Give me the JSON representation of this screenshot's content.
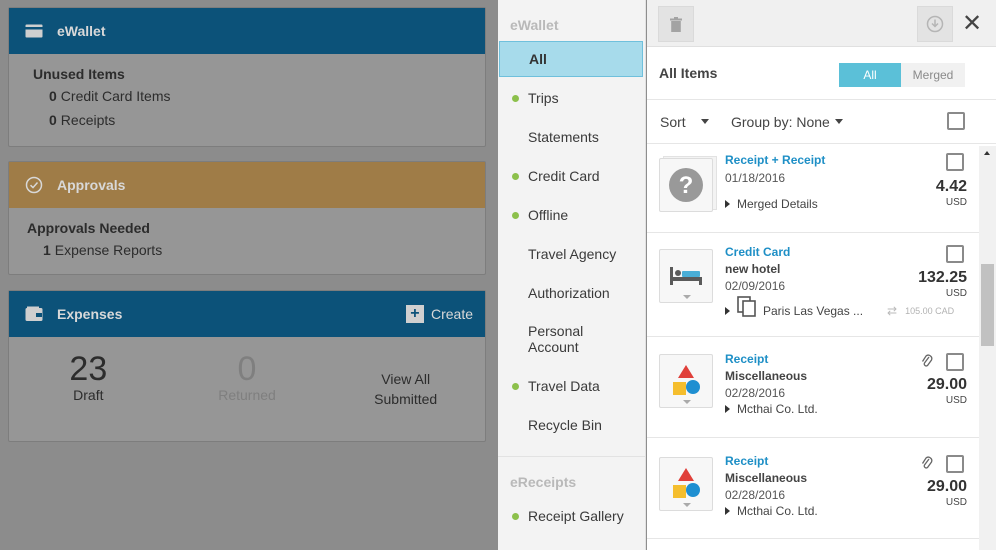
{
  "dashboard": {
    "wallet": {
      "title": "eWallet",
      "section": "Unused Items",
      "rows": [
        {
          "count": "0",
          "label": "Credit Card Items"
        },
        {
          "count": "0",
          "label": "Receipts"
        }
      ]
    },
    "approvals": {
      "title": "Approvals",
      "section": "Approvals Needed",
      "rows": [
        {
          "count": "1",
          "label": "Expense Reports"
        }
      ]
    },
    "expenses": {
      "title": "Expenses",
      "create_label": "Create",
      "draft": {
        "num": "23",
        "label": "Draft"
      },
      "returned": {
        "num": "0",
        "label": "Returned"
      },
      "view_all": {
        "line1": "View All",
        "line2": "Submitted"
      }
    }
  },
  "nav": {
    "section_ewallet": "eWallet",
    "section_ereceipts": "eReceipts",
    "items": [
      {
        "label": "All",
        "dot": false,
        "active": true
      },
      {
        "label": "Trips",
        "dot": true
      },
      {
        "label": "Statements",
        "dot": false
      },
      {
        "label": "Credit Card",
        "dot": true
      },
      {
        "label": "Offline",
        "dot": true
      },
      {
        "label": "Travel Agency",
        "dot": false
      },
      {
        "label": "Authorization",
        "dot": false
      },
      {
        "label": "Personal",
        "label2": "Account",
        "dot": false
      },
      {
        "label": "Travel Data",
        "dot": true
      },
      {
        "label": "Recycle Bin",
        "dot": false
      }
    ],
    "receipt_gallery": "Receipt Gallery"
  },
  "panel": {
    "close_glyph": "✕",
    "title": "All Items",
    "toggle": {
      "all": "All",
      "merged": "Merged"
    },
    "sort_label": "Sort",
    "group_by_label": "Group by: None",
    "items": [
      {
        "type": "Receipt + Receipt",
        "date": "01/18/2016",
        "detail": "Merged Details",
        "amount": "4.42",
        "currency": "USD",
        "icon": "question-icon"
      },
      {
        "type": "Credit Card",
        "name": "new hotel",
        "date": "02/09/2016",
        "detail": "Paris Las Vegas ...",
        "amount": "132.25",
        "currency": "USD",
        "converted": "105.00",
        "converted_currency": "CAD",
        "icon": "hotel-bed-icon"
      },
      {
        "type": "Receipt",
        "name": "Miscellaneous",
        "date": "02/28/2016",
        "detail": "Mcthai Co. Ltd.",
        "amount": "29.00",
        "currency": "USD",
        "icon": "shapes-icon"
      },
      {
        "type": "Receipt",
        "name": "Miscellaneous",
        "date": "02/28/2016",
        "detail": "Mcthai Co. Ltd.",
        "amount": "29.00",
        "currency": "USD",
        "icon": "shapes-icon"
      }
    ]
  },
  "colors": {
    "blue_header": "#0c5279",
    "orange_header": "#9f7c47",
    "active_nav": "#a7dbeb",
    "link_blue": "#1e8fc6",
    "toggle_on": "#5bc0d8",
    "green_dot": "#8cc04b"
  }
}
